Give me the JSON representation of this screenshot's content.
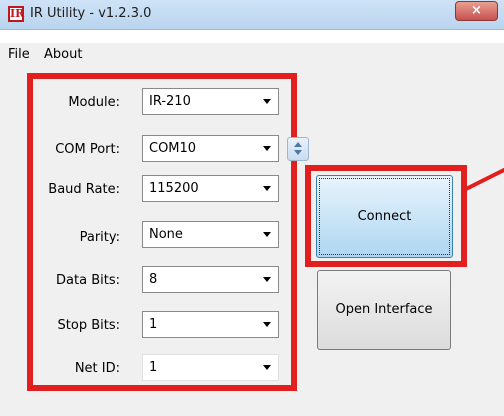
{
  "window": {
    "title": "IR Utility - v1.2.3.0",
    "icon_text": "IR",
    "close_glyph": "×"
  },
  "menu": {
    "items": [
      {
        "label": "File"
      },
      {
        "label": "About"
      }
    ]
  },
  "form": {
    "fields": [
      {
        "label": "Module:",
        "value": "IR-210"
      },
      {
        "label": "COM Port:",
        "value": "COM10"
      },
      {
        "label": "Baud Rate:",
        "value": "115200"
      },
      {
        "label": "Parity:",
        "value": "None"
      },
      {
        "label": "Data Bits:",
        "value": "8"
      },
      {
        "label": "Stop Bits:",
        "value": "1"
      },
      {
        "label": "Net ID:",
        "value": "1"
      }
    ]
  },
  "buttons": {
    "connect": "Connect",
    "open_interface": "Open Interface"
  },
  "colors": {
    "highlight": "#e11f1f",
    "connect_button": "#aed6f1",
    "title_bar": "#cfe3f7"
  },
  "icons": {
    "app": "ir-logo-icon",
    "close": "close-icon",
    "dropdown": "chevron-down-icon",
    "spin": "spin-updown-icon"
  }
}
